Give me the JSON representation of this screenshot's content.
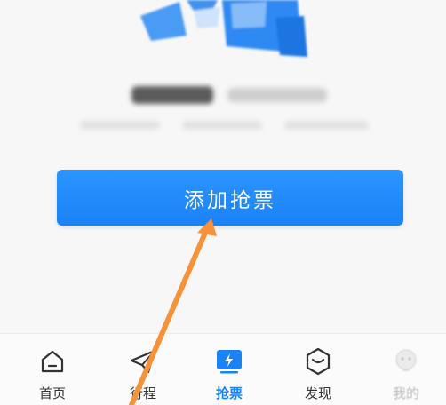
{
  "main": {
    "add_ticket_button_label": "添加抢票"
  },
  "tabbar": {
    "items": [
      {
        "label": "首页",
        "icon": "home-icon",
        "active": false
      },
      {
        "label": "行程",
        "icon": "paper-plane-icon",
        "active": false
      },
      {
        "label": "抢票",
        "icon": "lightning-ticket-icon",
        "active": true
      },
      {
        "label": "发现",
        "icon": "discover-icon",
        "active": false
      },
      {
        "label": "我的",
        "icon": "profile-icon",
        "active": false
      }
    ]
  },
  "colors": {
    "accent": "#1b82f5",
    "annotation_arrow": "#f5923a",
    "background": "#f7f7f8"
  }
}
